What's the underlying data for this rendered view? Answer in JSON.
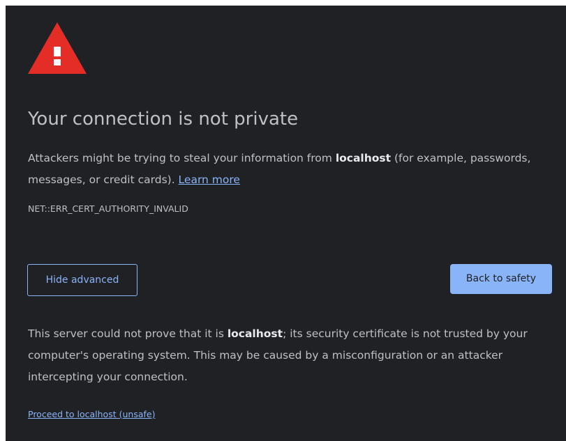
{
  "icon": {
    "name": "warning-triangle-icon",
    "color": "#e52d27",
    "mark": "!"
  },
  "colors": {
    "background": "#202124",
    "text": "#bdc1c6",
    "link": "#8ab4f8",
    "danger": "#e52d27"
  },
  "title": "Your connection is not private",
  "main_message": {
    "before_host": "Attackers might be trying to steal your information from ",
    "host": "localhost",
    "after_host": " (for example, passwords, messages, or credit cards). ",
    "learn_more": "Learn more"
  },
  "error_code": "NET::ERR_CERT_AUTHORITY_INVALID",
  "buttons": {
    "hide_advanced": "Hide advanced",
    "back_to_safety": "Back to safety"
  },
  "details": {
    "before_host": "This server could not prove that it is ",
    "host": "localhost",
    "after_host": "; its security certificate is not trusted by your computer's operating system. This may be caused by a misconfiguration or an attacker intercepting your connection."
  },
  "proceed_link": "Proceed to localhost (unsafe)"
}
